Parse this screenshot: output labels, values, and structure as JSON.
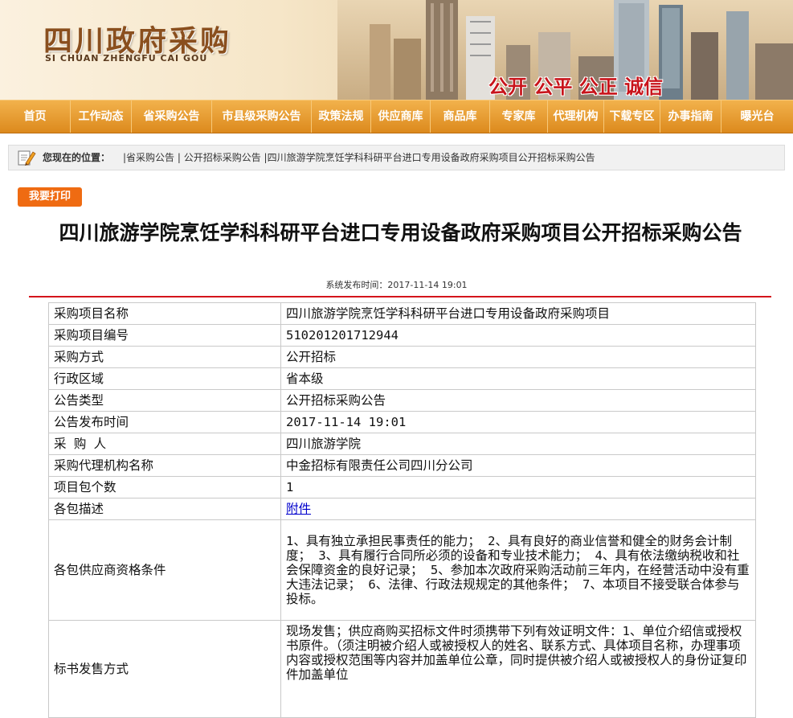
{
  "banner": {
    "logo_cn": "四川政府采购",
    "logo_en": "SI CHUAN ZHENGFU CAI GOU",
    "slogan": "公开 公平 公正 诚信"
  },
  "nav": {
    "items": [
      "首页",
      "工作动态",
      "省采购公告",
      "市县级采购公告",
      "政策法规",
      "供应商库",
      "商品库",
      "专家库",
      "代理机构",
      "下载专区",
      "办事指南",
      "曝光台"
    ]
  },
  "breadcrumb": {
    "label": "您现在的位置：",
    "path": "|省采购公告 | 公开招标采购公告 |四川旅游学院烹饪学科科研平台进口专用设备政府采购项目公开招标采购公告"
  },
  "print_button": "我要打印",
  "title": "四川旅游学院烹饪学科科研平台进口专用设备政府采购项目公开招标采购公告",
  "pub_time": "系统发布时间：2017-11-14 19:01",
  "table": {
    "rows": [
      {
        "key": "采购项目名称",
        "value": "四川旅游学院烹饪学科科研平台进口专用设备政府采购项目"
      },
      {
        "key": "采购项目编号",
        "value": "510201201712944"
      },
      {
        "key": "采购方式",
        "value": "公开招标"
      },
      {
        "key": "行政区域",
        "value": "省本级"
      },
      {
        "key": "公告类型",
        "value": "公开招标采购公告"
      },
      {
        "key": "公告发布时间",
        "value": "2017-11-14 19:01"
      },
      {
        "key": "采 购 人",
        "value": "四川旅游学院"
      },
      {
        "key": "采购代理机构名称",
        "value": "中金招标有限责任公司四川分公司"
      },
      {
        "key": "项目包个数",
        "value": "1"
      },
      {
        "key": "各包描述",
        "value": "附件"
      },
      {
        "key": "各包供应商资格条件",
        "value": "1、具有独立承担民事责任的能力； 2、具有良好的商业信誉和健全的财务会计制度； 3、具有履行合同所必须的设备和专业技术能力； 4、具有依法缴纳税收和社会保障资金的良好记录； 5、参加本次政府采购活动前三年内，在经营活动中没有重大违法记录； 6、法律、行政法规规定的其他条件； 7、本项目不接受联合体参与投标。"
      },
      {
        "key": "标书发售方式",
        "value": "现场发售；供应商购买招标文件时须携带下列有效证明文件：1、单位介绍信或授权书原件。（须注明被介绍人或被授权人的姓名、联系方式、具体项目名称，办理事项内容或授权范围等内容并加盖单位公章，同时提供被介绍人或被授权人的身份证复印件加盖单位"
      }
    ]
  }
}
